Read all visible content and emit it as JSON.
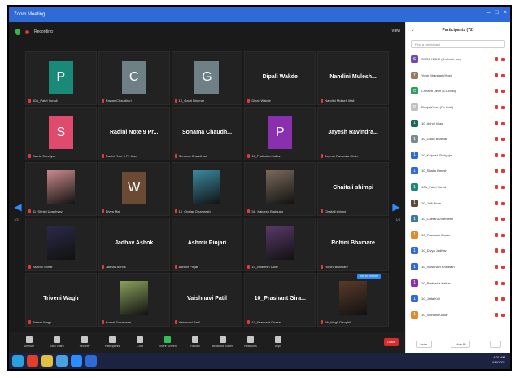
{
  "window": {
    "title": "Zoom Meeting"
  },
  "meeting": {
    "recording_label": "Recording",
    "view_label": "View",
    "page_left": "1/3",
    "page_right": "1/3",
    "admit_label": "Ask to Unmute"
  },
  "tiles": [
    {
      "label": "10A_Patel Vonali",
      "type": "avatar",
      "letter": "P",
      "color": "#1a8a78"
    },
    {
      "label": "Pawan Chaudhari",
      "type": "avatar",
      "letter": "C",
      "color": "#6f7f86"
    },
    {
      "label": "10_Gauri Bhamar",
      "type": "avatar",
      "letter": "G",
      "color": "#6f7f86"
    },
    {
      "label": "Dipali Wakde",
      "type": "name",
      "display": "Dipali Wakde"
    },
    {
      "label": "Nandini Mulaeh Mali",
      "type": "name",
      "display": "Nandini Mulesh..."
    },
    {
      "label": "Sweta Sonalya",
      "type": "avatar",
      "letter": "S",
      "color": "#e04a6c"
    },
    {
      "label": "Radini Rote 9 Fir Awe",
      "type": "name",
      "display": "Radini Note 9 Pr..."
    },
    {
      "label": "Sonama Chaudhari",
      "type": "name",
      "display": "Sonama Chaudh..."
    },
    {
      "label": "11_Pratiksha Kalkar",
      "type": "avatar",
      "letter": "P",
      "color": "#8a2fb0"
    },
    {
      "label": "Jayesh Ravindra Chole",
      "type": "name",
      "display": "Jayesh Ravindra..."
    },
    {
      "label": "11_Shristi Upadhyay",
      "type": "photo",
      "color": "#c98a8a"
    },
    {
      "label": "Divya Mali",
      "type": "avatar",
      "letter": "W",
      "color": "#6b4a34"
    },
    {
      "label": "10_Chetan Dharmesh",
      "type": "photo",
      "color": "#3a8aa0"
    },
    {
      "label": "9A_Kalpesh Badgujar",
      "type": "photo",
      "color": "#7a6a5a"
    },
    {
      "label": "Chaitali shimpi",
      "type": "name",
      "display": "Chaitali shimpi"
    },
    {
      "label": "Ashvini Sonar",
      "type": "photo",
      "color": "#2a2a4a"
    },
    {
      "label": "Jadhav Ashok",
      "type": "name",
      "display": "Jadhav Ashok"
    },
    {
      "label": "Ashmir Pinjari",
      "type": "name",
      "display": "Ashmir Pinjari"
    },
    {
      "label": "10_Bhavesh Ulale",
      "type": "photo",
      "color": "#5a3a6a"
    },
    {
      "label": "Rohini Bhamare",
      "type": "name",
      "display": "Rohini Bhamare"
    },
    {
      "label": "Triveni Wagh",
      "type": "name",
      "display": "Triveni Wagh"
    },
    {
      "label": "Komal Sonawane",
      "type": "photo",
      "color": "#8aa05a"
    },
    {
      "label": "Vaishnavi Patil",
      "type": "name",
      "display": "Vaishnavi Patil"
    },
    {
      "label": "10_Prashant Girase",
      "type": "name",
      "display": "10_Prashant Gira..."
    },
    {
      "label": "9A_Megh Deoghil",
      "type": "photo",
      "color": "#5a3a2a"
    }
  ],
  "toolbar": [
    {
      "label": "Unmute",
      "green": false
    },
    {
      "label": "Stop Video",
      "green": false
    },
    {
      "label": "Security",
      "green": false
    },
    {
      "label": "Participants",
      "green": false
    },
    {
      "label": "Chat",
      "green": false
    },
    {
      "label": "Share Screen",
      "green": true
    },
    {
      "label": "Record",
      "green": false
    },
    {
      "label": "Breakout Rooms",
      "green": false
    },
    {
      "label": "Reactions",
      "green": false
    },
    {
      "label": "Apps",
      "green": false
    }
  ],
  "toolbar_leave": "Leave",
  "panel": {
    "title": "Participants (72)",
    "search_placeholder": "Find a participant",
    "participants": [
      {
        "name": "SHRE NOLE (Co-host, me)",
        "color": "#6f4ab0",
        "letter": "S"
      },
      {
        "name": "Yogir Bhandari (Host)",
        "color": "#9a7a5a",
        "letter": "Y"
      },
      {
        "name": "Chhaya Dekh (Co-host)",
        "color": "#2ea05a",
        "letter": "C"
      },
      {
        "name": "Pooja Kisan (Co-host)",
        "color": "#c0c0c0",
        "letter": "P"
      },
      {
        "name": "10_Ashni Vilas",
        "color": "#1a6a5a",
        "letter": "1"
      },
      {
        "name": "10_Gauri Bhamar",
        "color": "#7a8a90",
        "letter": "1"
      },
      {
        "name": "10_Kalpesh Badgujar",
        "color": "#2f6bd8",
        "letter": "1"
      },
      {
        "name": "10_Shaila Umesh",
        "color": "#2f6bd8",
        "letter": "1"
      },
      {
        "name": "10A_Patel Vonali",
        "color": "#1a8a78",
        "letter": "1"
      },
      {
        "name": "10_Jalil Birne",
        "color": "#5a4a3a",
        "letter": "1"
      },
      {
        "name": "10_Chetan Dharmesh",
        "color": "#3a7aa0",
        "letter": "1"
      },
      {
        "name": "10_Prashant Girase",
        "color": "#e08a2a",
        "letter": "1"
      },
      {
        "name": "10_Divya Jadhav",
        "color": "#2f6bd8",
        "letter": "1"
      },
      {
        "name": "10_Vaishnavi Khadsan",
        "color": "#2f6bd8",
        "letter": "1"
      },
      {
        "name": "10_Pratiksha Kalkar",
        "color": "#8a2fb0",
        "letter": "1"
      },
      {
        "name": "10_Jalta Koli",
        "color": "#2f6bd8",
        "letter": "1"
      },
      {
        "name": "10_Sidhdhi Kotkar",
        "color": "#e08a2a",
        "letter": "1"
      }
    ],
    "invite_label": "Invite",
    "mute_all_label": "Mute All",
    "more_label": "..."
  },
  "taskbar": {
    "time": "4:20 AM",
    "date": "6/6/2021",
    "apps": [
      {
        "name": "start-icon",
        "color": "#2aa0e0"
      },
      {
        "name": "chrome-icon",
        "color": "#e0402a"
      },
      {
        "name": "files-icon",
        "color": "#e0c040"
      },
      {
        "name": "photos-icon",
        "color": "#4aa0e0"
      },
      {
        "name": "zoom-icon",
        "color": "#2d8cff"
      },
      {
        "name": "word-icon",
        "color": "#2f6bd8"
      }
    ]
  }
}
